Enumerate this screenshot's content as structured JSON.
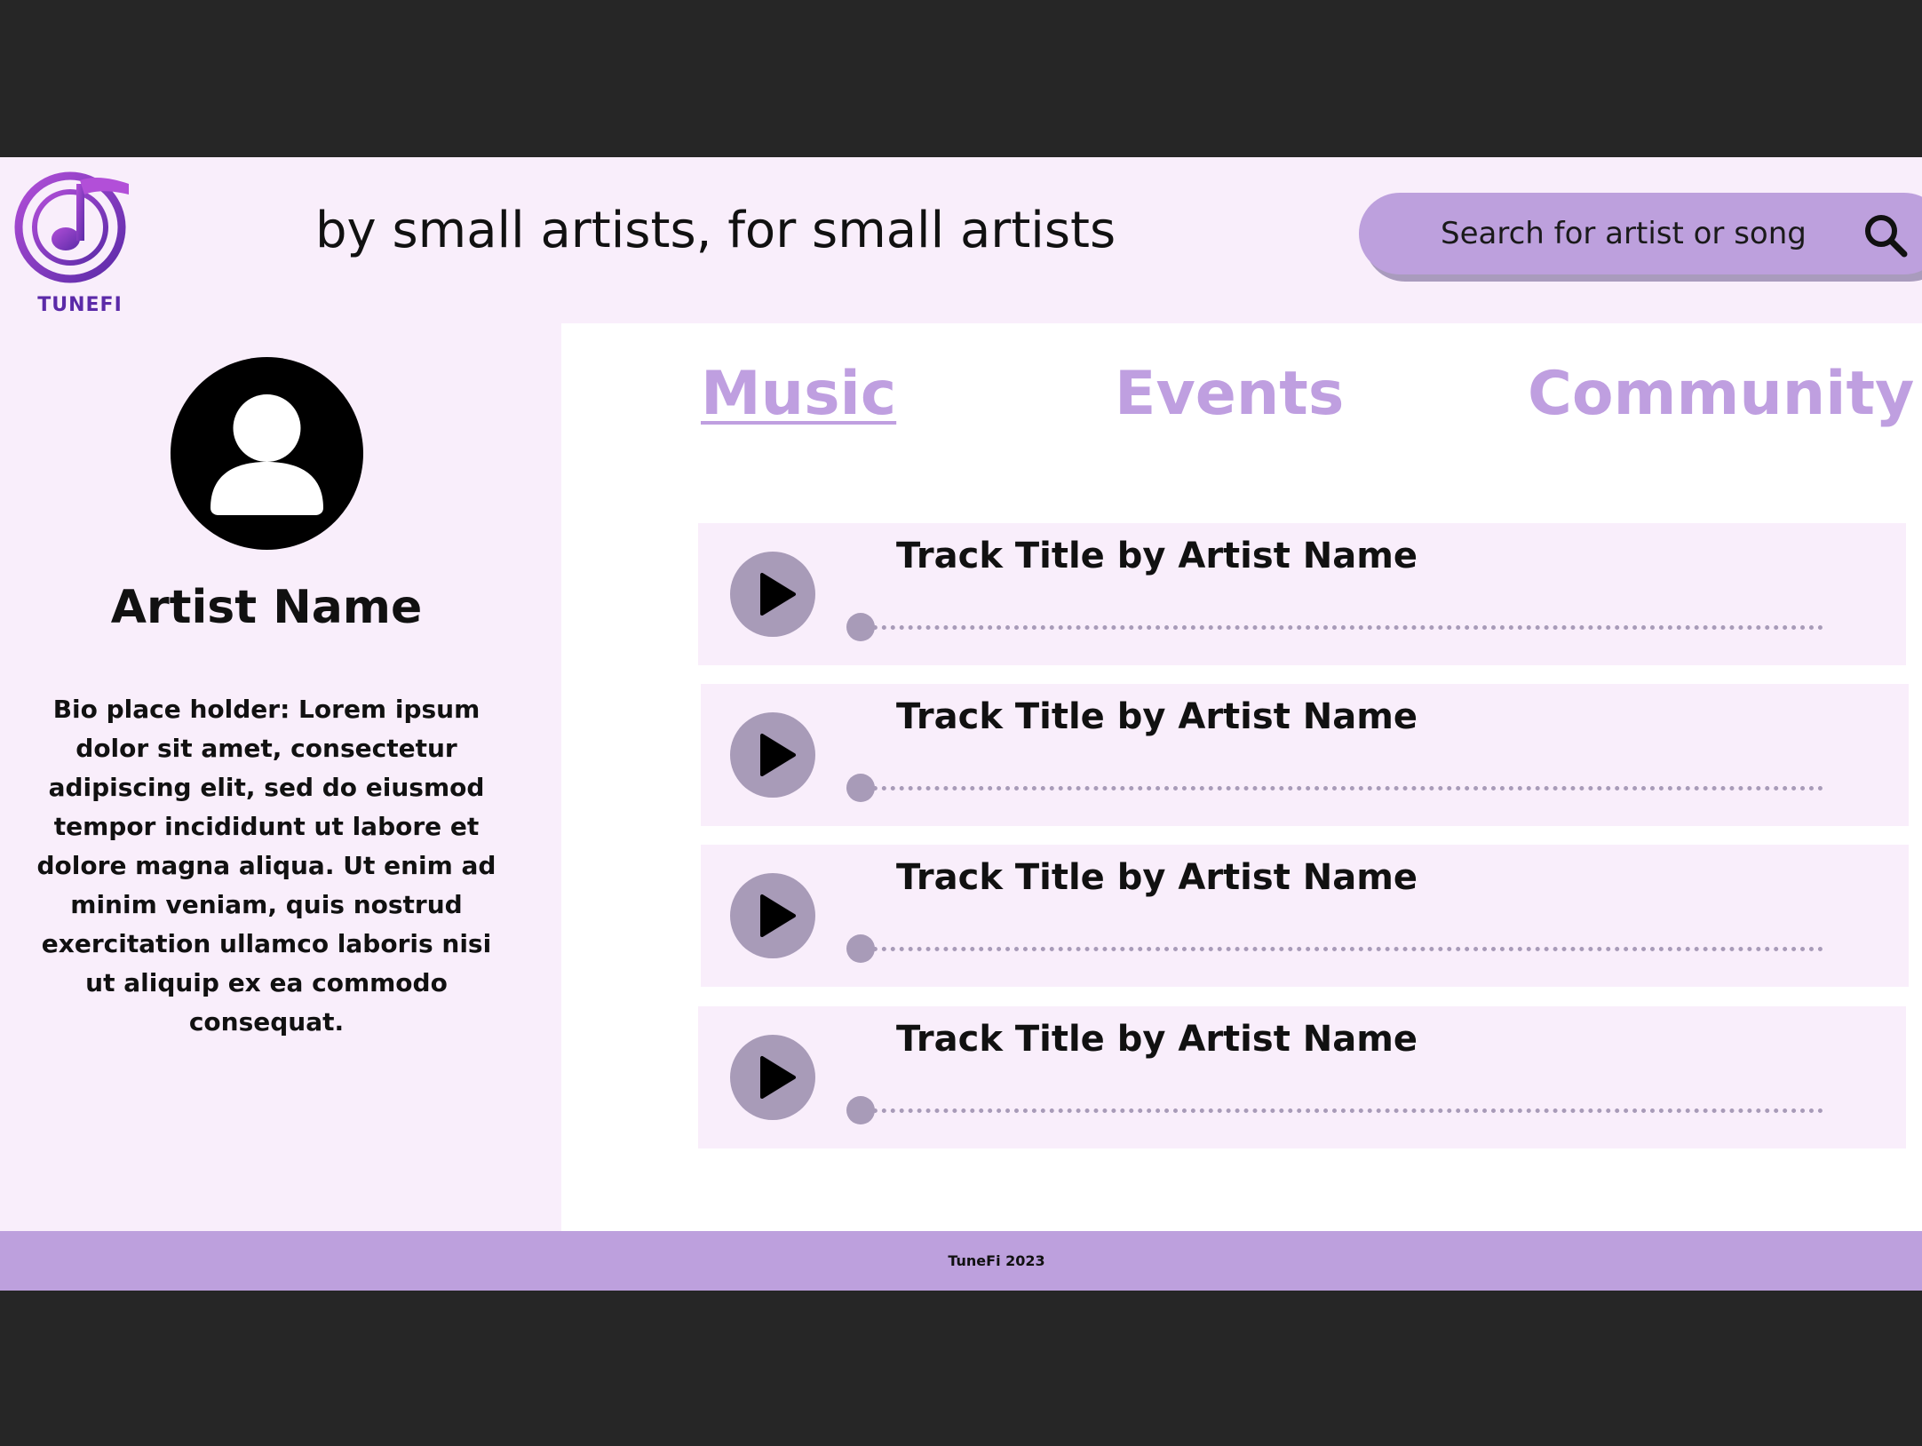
{
  "header": {
    "logo_text": "TUNEFI",
    "tagline": "by small artists, for small artists",
    "search_placeholder": "Search for artist or song"
  },
  "artist": {
    "name": "Artist Name",
    "bio": "Bio place holder: Lorem ipsum dolor sit amet, consectetur adipiscing elit, sed do eiusmod tempor incididunt ut labore et dolore magna aliqua. Ut enim ad minim veniam, quis nostrud exercitation ullamco laboris nisi ut aliquip ex ea commodo consequat."
  },
  "nav": {
    "tabs": [
      {
        "label": "Music",
        "active": true
      },
      {
        "label": "Events",
        "active": false
      },
      {
        "label": "Community",
        "active": false
      }
    ]
  },
  "tracks": [
    {
      "title": "Track Title by Artist Name",
      "progress": 0
    },
    {
      "title": "Track Title by Artist Name",
      "progress": 0
    },
    {
      "title": "Track Title by Artist Name",
      "progress": 0
    },
    {
      "title": "Track Title by Artist Name",
      "progress": 0
    }
  ],
  "footer": {
    "text": "TuneFi 2023"
  },
  "colors": {
    "accent": "#bda0dd",
    "nav_tab": "#bf9fe0",
    "panel": "#f9eefb",
    "control": "#a89bb8",
    "logo": "#7b3fd0"
  }
}
